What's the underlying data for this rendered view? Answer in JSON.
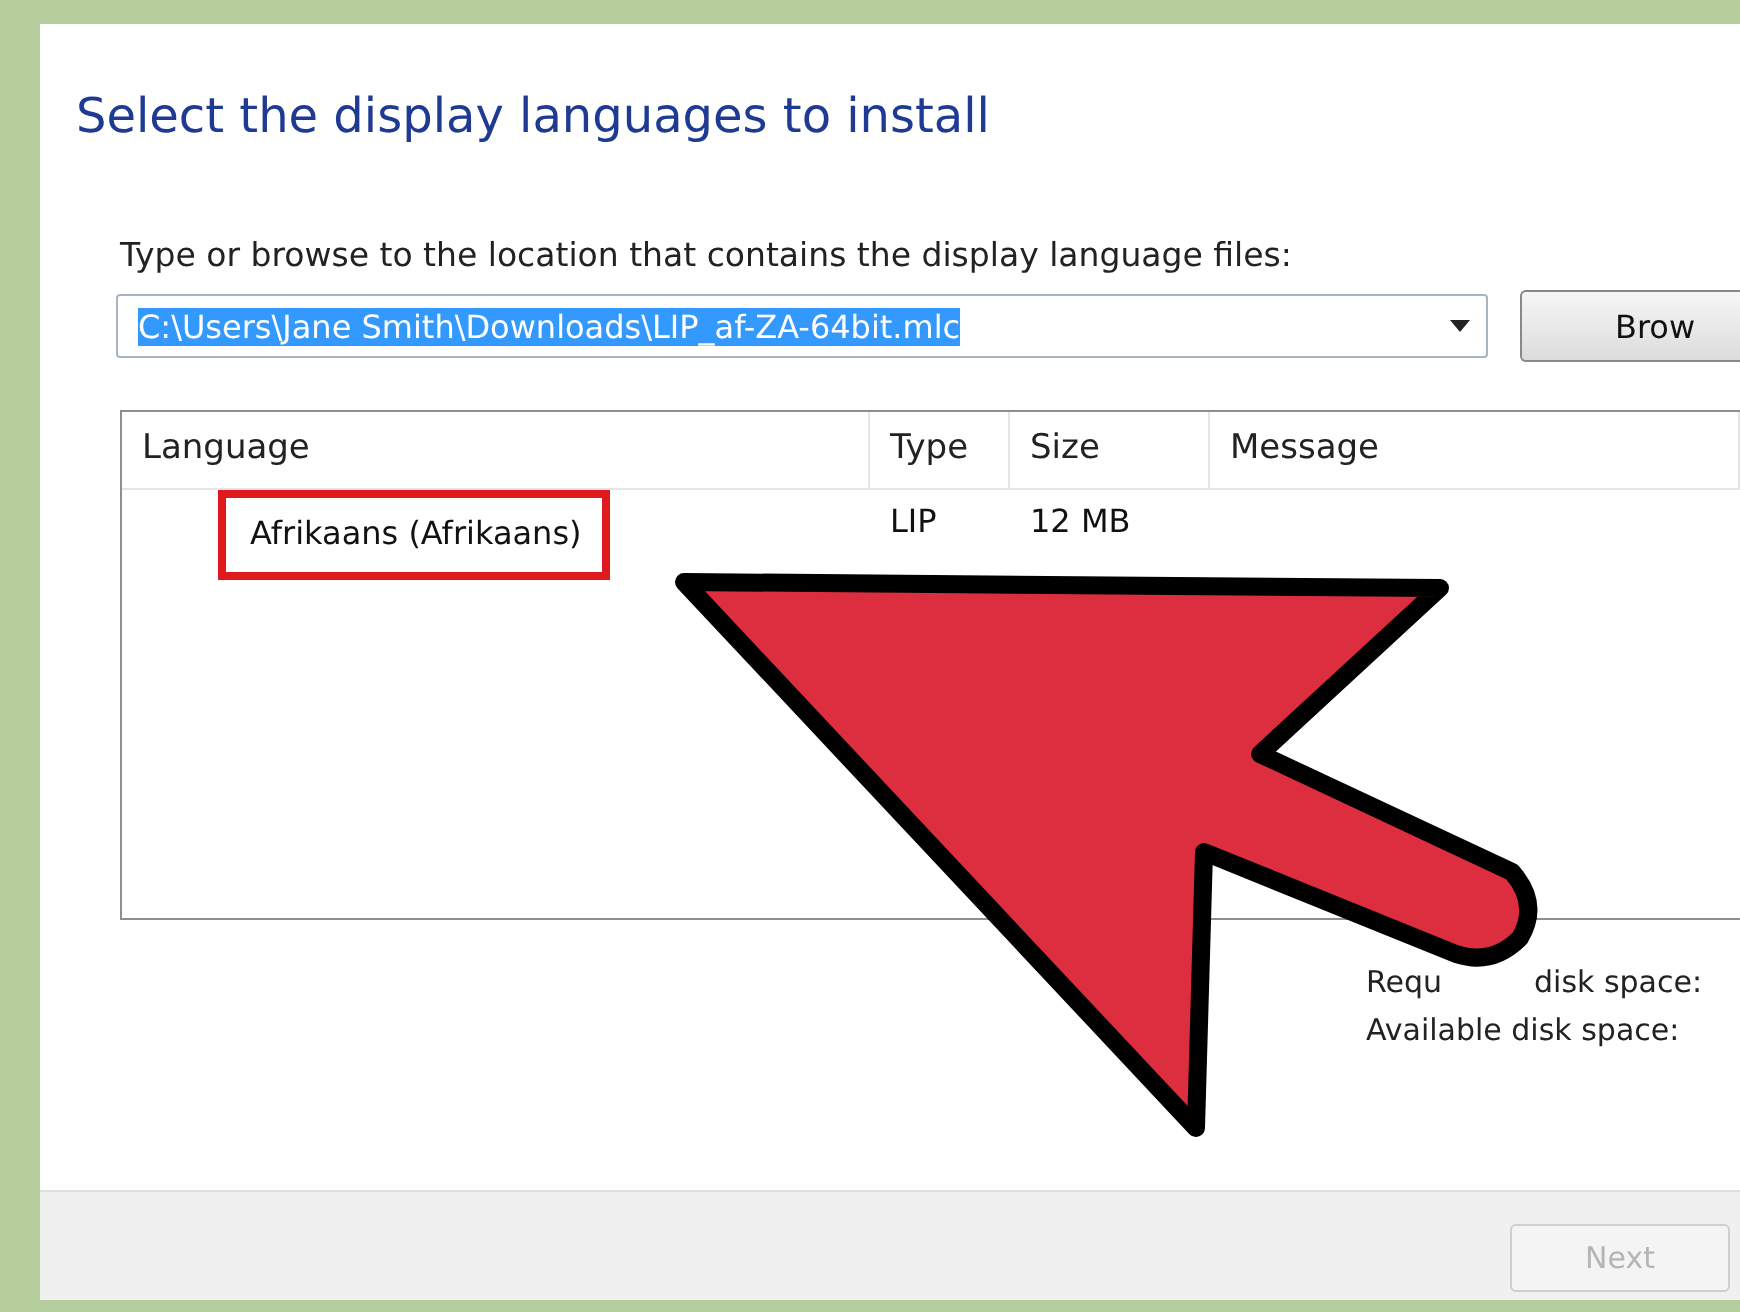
{
  "title": "Select the display languages to install",
  "location": {
    "label": "Type or browse to the location that contains the display language files:",
    "value": "C:\\Users\\Jane Smith\\Downloads\\LIP_af-ZA-64bit.mlc",
    "value_selected": true,
    "browse_button": "Brow"
  },
  "table": {
    "columns": [
      "Language",
      "Type",
      "Size",
      "Message"
    ],
    "rows": [
      {
        "cells": [
          "Afrikaans (Afrikaans)",
          "LIP",
          "12 MB",
          ""
        ],
        "highlighted": true
      }
    ]
  },
  "disk_space": [
    {
      "parts": [
        "Requ",
        "disk space:"
      ]
    },
    {
      "parts": [
        "Available disk space:"
      ]
    }
  ],
  "footer": {
    "next_button": {
      "label": "Next",
      "disabled": true
    }
  },
  "annotation": {
    "kind": "arrow"
  }
}
